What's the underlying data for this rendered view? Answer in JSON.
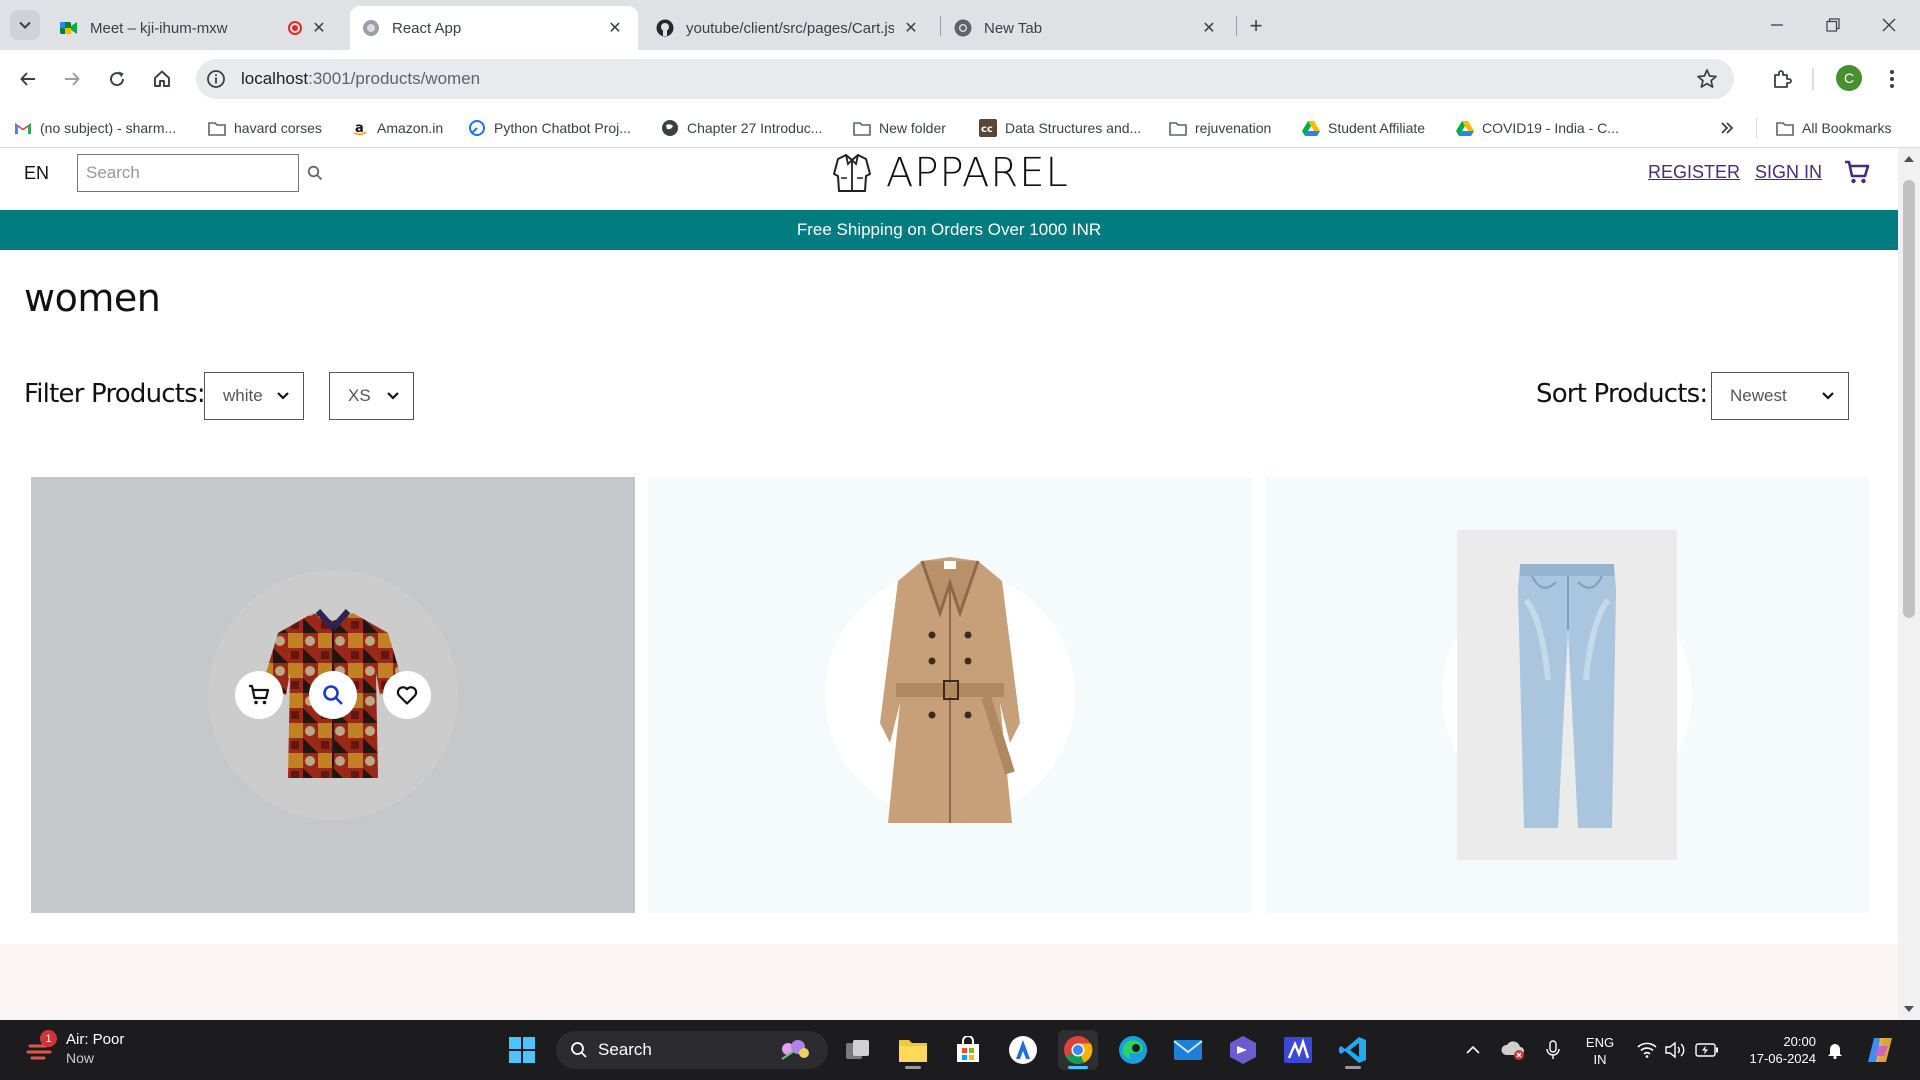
{
  "browser": {
    "tabs": [
      {
        "title": "Meet – kji-ihum-mxw",
        "recording": true
      },
      {
        "title": "React App",
        "active": true
      },
      {
        "title": "youtube/client/src/pages/Cart.js"
      },
      {
        "title": "New Tab"
      }
    ],
    "url": {
      "host": "localhost",
      "path": ":3001/products/women"
    },
    "profile_initial": "C",
    "bookmarks": [
      {
        "label": "(no subject) - sharm...",
        "icon": "gmail-icon"
      },
      {
        "label": "havard corses",
        "icon": "folder-icon"
      },
      {
        "label": "Amazon.in",
        "icon": "amazon-icon"
      },
      {
        "label": "Python Chatbot Proj...",
        "icon": "link-icon"
      },
      {
        "label": "Chapter 27 Introduc...",
        "icon": "globe-icon"
      },
      {
        "label": "New folder",
        "icon": "folder-icon"
      },
      {
        "label": "Data Structures and...",
        "icon": "cc-icon"
      },
      {
        "label": "rejuvenation",
        "icon": "folder-icon"
      },
      {
        "label": "Student Affiliate",
        "icon": "drive-icon"
      },
      {
        "label": "COVID19 - India - C...",
        "icon": "drive-icon"
      }
    ],
    "all_bookmarks_label": "All Bookmarks"
  },
  "site": {
    "lang": "EN",
    "search_placeholder": "Search",
    "logo_text": "APPAREL",
    "register_label": "REGISTER",
    "signin_label": "SIGN IN",
    "announcement": "Free Shipping on Orders Over 1000 INR",
    "category_title": "women",
    "filter_label": "Filter Products:",
    "filter_color": "white",
    "filter_size": "XS",
    "sort_label": "Sort Products:",
    "sort_value": "Newest",
    "colors": {
      "teal": "#007b7f",
      "link": "#4b2a7a"
    }
  },
  "products": [
    {
      "name": "patterned-shirt",
      "hovered": true,
      "bg": "#f5fbfd"
    },
    {
      "name": "trench-coat",
      "hovered": false,
      "bg": "#f5fbfd"
    },
    {
      "name": "light-jeans",
      "hovered": false,
      "bg": "#f5fbfd"
    }
  ],
  "taskbar": {
    "weather_title": "Air: Poor",
    "weather_sub": "Now",
    "weather_badge": "1",
    "search_label": "Search",
    "lang_line1": "ENG",
    "lang_line2": "IN",
    "time": "20:00",
    "date": "17-06-2024"
  }
}
